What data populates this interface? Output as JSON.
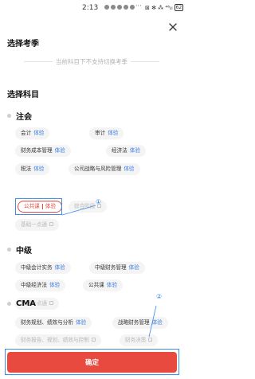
{
  "status_bar": {
    "time": "2:13",
    "more": "···",
    "icons": "⊠ ✻ ⁂ ⁴⁶ᵢₗₗ",
    "battery": "62"
  },
  "header": {
    "title": "选择考季",
    "notice": "当前科目下不支持切换考季"
  },
  "subjects_title": "选择科目",
  "groups": {
    "faz": {
      "title": "注会",
      "items": [
        {
          "label": "会计",
          "tag": "体验"
        },
        {
          "label": "审计",
          "tag": "体验"
        },
        {
          "label": "财务成本管理",
          "tag": "体验"
        },
        {
          "label": "经济法",
          "tag": "体验"
        },
        {
          "label": "税法",
          "tag": "体验"
        },
        {
          "label": "公司战略与风险管理",
          "tag": "体验"
        },
        {
          "label": "公共课",
          "tag": "体验"
        },
        {
          "label": "综合阶段"
        },
        {
          "label": "基础一点通"
        }
      ]
    },
    "middle": {
      "title": "中级",
      "items": [
        {
          "label": "中级会计实务",
          "tag": "体验"
        },
        {
          "label": "中级财务管理",
          "tag": "体验"
        },
        {
          "label": "中级经济法",
          "tag": "体验"
        },
        {
          "label": "公共课",
          "tag": "体验"
        },
        {
          "label": "基础一点通"
        }
      ]
    },
    "cma": {
      "title": "CMA",
      "items": [
        {
          "label": "财务规划、绩效与分析",
          "tag": "体验"
        },
        {
          "label": "战略财务管理",
          "tag": "体验"
        },
        {
          "label": "财务报告、规划、绩效与控制"
        },
        {
          "label": "财务决策"
        }
      ]
    }
  },
  "annotations": {
    "one": "①",
    "two": "②"
  },
  "footer": {
    "confirm_label": "确定"
  },
  "colors": {
    "accent_red": "#e84a3f",
    "tag_blue": "#3b7de0",
    "annotation_blue": "#3a8ee6"
  }
}
